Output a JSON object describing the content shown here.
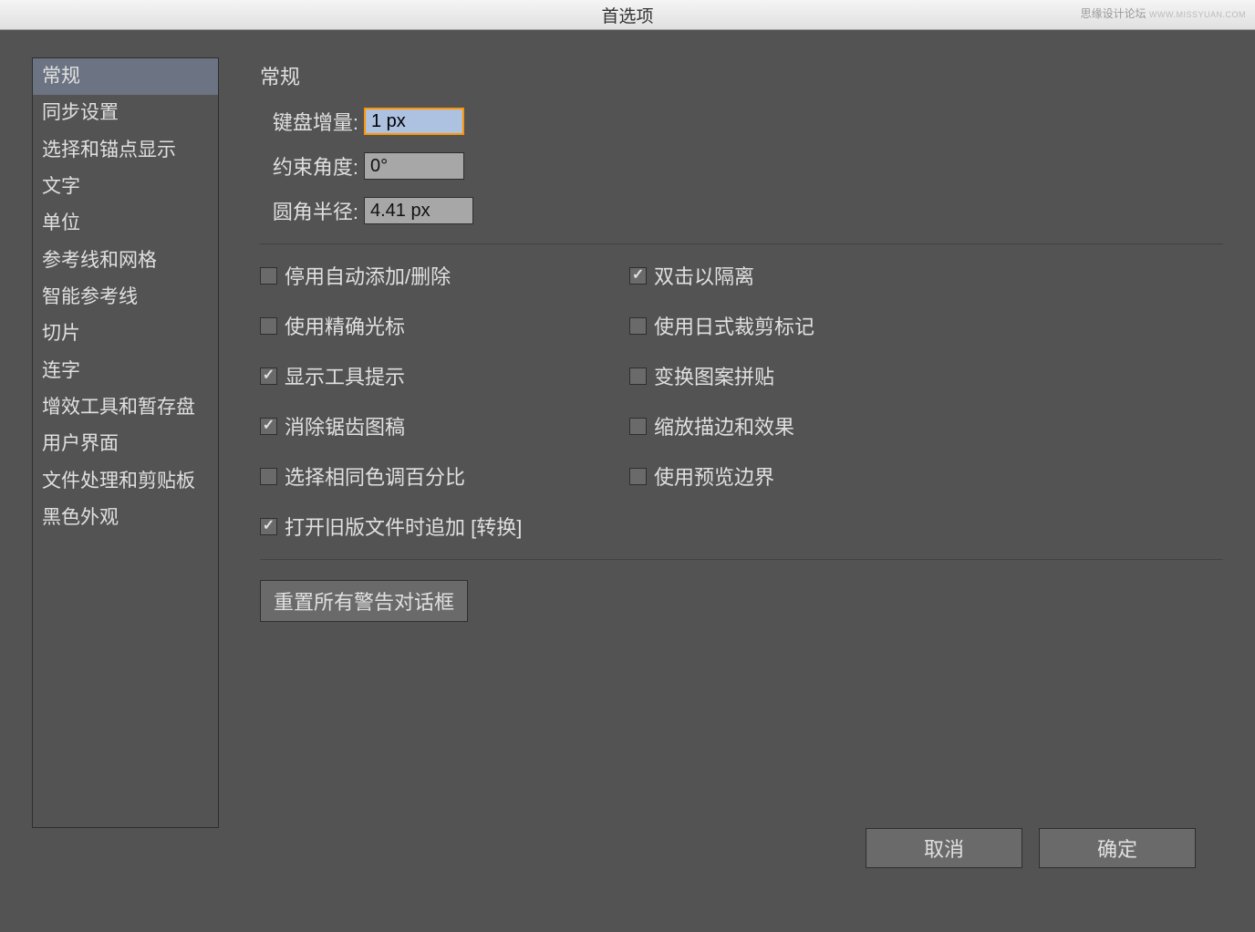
{
  "title": "首选项",
  "watermark": {
    "text": "思缘设计论坛",
    "url": "WWW.MISSYUAN.COM"
  },
  "sidebar": {
    "items": [
      {
        "label": "常规",
        "selected": true
      },
      {
        "label": "同步设置",
        "selected": false
      },
      {
        "label": "选择和锚点显示",
        "selected": false
      },
      {
        "label": "文字",
        "selected": false
      },
      {
        "label": "单位",
        "selected": false
      },
      {
        "label": "参考线和网格",
        "selected": false
      },
      {
        "label": "智能参考线",
        "selected": false
      },
      {
        "label": "切片",
        "selected": false
      },
      {
        "label": "连字",
        "selected": false
      },
      {
        "label": "增效工具和暂存盘",
        "selected": false
      },
      {
        "label": "用户界面",
        "selected": false
      },
      {
        "label": "文件处理和剪贴板",
        "selected": false
      },
      {
        "label": "黑色外观",
        "selected": false
      }
    ]
  },
  "panel": {
    "title": "常规",
    "fields": {
      "keyboard_increment": {
        "label": "键盘增量:",
        "value": "1 px",
        "focused": true
      },
      "constrain_angle": {
        "label": "约束角度:",
        "value": "0°",
        "focused": false
      },
      "corner_radius": {
        "label": "圆角半径:",
        "value": "4.41 px",
        "focused": false
      }
    },
    "checkboxes_left": [
      {
        "label": "停用自动添加/删除",
        "checked": false
      },
      {
        "label": "使用精确光标",
        "checked": false
      },
      {
        "label": "显示工具提示",
        "checked": true
      },
      {
        "label": "消除锯齿图稿",
        "checked": true
      },
      {
        "label": "选择相同色调百分比",
        "checked": false
      }
    ],
    "checkboxes_right": [
      {
        "label": "双击以隔离",
        "checked": true
      },
      {
        "label": "使用日式裁剪标记",
        "checked": false
      },
      {
        "label": "变换图案拼贴",
        "checked": false
      },
      {
        "label": "缩放描边和效果",
        "checked": false
      },
      {
        "label": "使用预览边界",
        "checked": false
      }
    ],
    "checkbox_bottom": {
      "label": "打开旧版文件时追加 [转换]",
      "checked": true
    },
    "reset_button": "重置所有警告对话框"
  },
  "footer": {
    "cancel": "取消",
    "ok": "确定"
  }
}
